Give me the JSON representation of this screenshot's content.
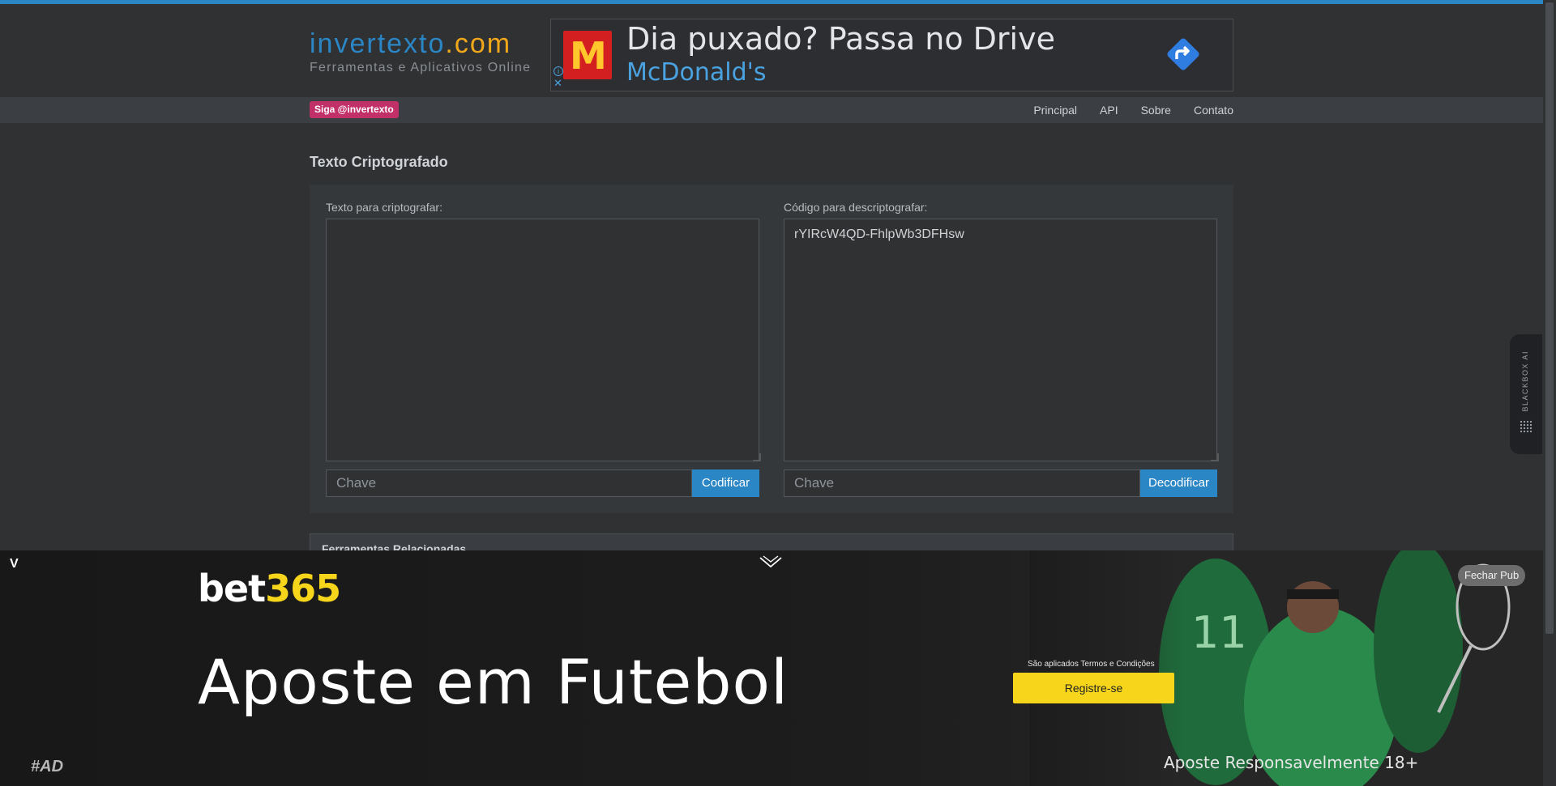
{
  "site": {
    "logo_main_a": "invertexto",
    "logo_main_b": ".com",
    "logo_sub": "Ferramentas e Aplicativos Online"
  },
  "top_ad": {
    "headline": "Dia puxado? Passa no Drive",
    "brand": "McDonald's",
    "info_icon": "i",
    "close_icon": "✕"
  },
  "navbar": {
    "follow_label": "Siga @invertexto",
    "links": [
      "Principal",
      "API",
      "Sobre",
      "Contato"
    ]
  },
  "main": {
    "title": "Texto Criptografado",
    "left": {
      "label": "Texto para criptografar:",
      "value": "",
      "key_placeholder": "Chave",
      "button": "Codificar"
    },
    "right": {
      "label": "Código para descriptografar:",
      "value": "rYIRcW4QD-FhlpWb3DFHsw",
      "key_placeholder": "Chave",
      "button": "Decodificar"
    },
    "related_title": "Ferramentas Relacionadas"
  },
  "extension": {
    "label": "BLACKBOX AI"
  },
  "bottom_ad": {
    "v_mark": "V",
    "logo_white": "bet",
    "logo_yellow": "365",
    "headline": "Aposte em Futebol",
    "terms": "São aplicados Termos e Condições",
    "register": "Registre-se",
    "responsible": "Aposte Responsavelmente 18+",
    "hash_ad": "#AD",
    "close": "Fechar Pub"
  }
}
